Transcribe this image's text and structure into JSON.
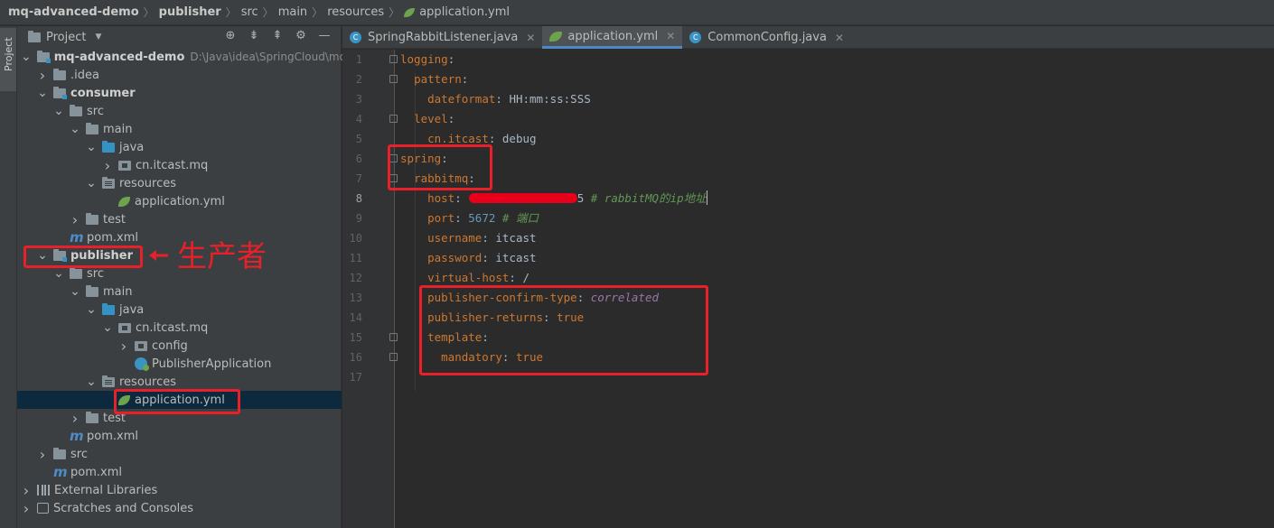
{
  "breadcrumb": [
    "mq-advanced-demo",
    "publisher",
    "src",
    "main",
    "resources",
    "application.yml"
  ],
  "sidebar_tab": "Project",
  "project_panel": {
    "title": "Project",
    "tree": [
      {
        "label": "mq-advanced-demo",
        "path": "D:\\Java\\idea\\SpringCloud\\mq-ac",
        "depth": 0,
        "chevron": "down",
        "icon": "module-folder",
        "bold": true
      },
      {
        "label": ".idea",
        "depth": 1,
        "chevron": "right",
        "icon": "folder"
      },
      {
        "label": "consumer",
        "depth": 1,
        "chevron": "down",
        "icon": "module-folder",
        "bold": true
      },
      {
        "label": "src",
        "depth": 2,
        "chevron": "down",
        "icon": "folder"
      },
      {
        "label": "main",
        "depth": 3,
        "chevron": "down",
        "icon": "folder"
      },
      {
        "label": "java",
        "depth": 4,
        "chevron": "down",
        "icon": "source-folder"
      },
      {
        "label": "cn.itcast.mq",
        "depth": 5,
        "chevron": "right",
        "icon": "package"
      },
      {
        "label": "resources",
        "depth": 4,
        "chevron": "down",
        "icon": "resources-folder"
      },
      {
        "label": "application.yml",
        "depth": 5,
        "chevron": "none",
        "icon": "spring-yml"
      },
      {
        "label": "test",
        "depth": 3,
        "chevron": "right",
        "icon": "folder"
      },
      {
        "label": "pom.xml",
        "depth": 2,
        "chevron": "none",
        "icon": "maven"
      },
      {
        "label": "publisher",
        "depth": 1,
        "chevron": "down",
        "icon": "module-folder",
        "bold": true
      },
      {
        "label": "src",
        "depth": 2,
        "chevron": "down",
        "icon": "folder"
      },
      {
        "label": "main",
        "depth": 3,
        "chevron": "down",
        "icon": "folder"
      },
      {
        "label": "java",
        "depth": 4,
        "chevron": "down",
        "icon": "source-folder"
      },
      {
        "label": "cn.itcast.mq",
        "depth": 5,
        "chevron": "down",
        "icon": "package"
      },
      {
        "label": "config",
        "depth": 6,
        "chevron": "right",
        "icon": "package"
      },
      {
        "label": "PublisherApplication",
        "depth": 6,
        "chevron": "none",
        "icon": "spring-class"
      },
      {
        "label": "resources",
        "depth": 4,
        "chevron": "down",
        "icon": "resources-folder"
      },
      {
        "label": "application.yml",
        "depth": 5,
        "chevron": "none",
        "icon": "spring-yml",
        "selected": true
      },
      {
        "label": "test",
        "depth": 3,
        "chevron": "right",
        "icon": "folder"
      },
      {
        "label": "pom.xml",
        "depth": 2,
        "chevron": "none",
        "icon": "maven"
      },
      {
        "label": "src",
        "depth": 1,
        "chevron": "right",
        "icon": "folder"
      },
      {
        "label": "pom.xml",
        "depth": 1,
        "chevron": "none",
        "icon": "maven"
      },
      {
        "label": "External Libraries",
        "depth": 0,
        "chevron": "right",
        "icon": "library"
      },
      {
        "label": "Scratches and Consoles",
        "depth": 0,
        "chevron": "right",
        "icon": "scratches"
      }
    ]
  },
  "tabs": [
    {
      "label": "SpringRabbitListener.java",
      "icon": "java-class",
      "active": false
    },
    {
      "label": "application.yml",
      "icon": "spring-yml",
      "active": true
    },
    {
      "label": "CommonConfig.java",
      "icon": "java-class",
      "active": false
    }
  ],
  "annotation": {
    "label": "生产者",
    "color": "#e8202a"
  },
  "editor": {
    "current_line": 8,
    "lines": [
      {
        "n": "1",
        "indent": "",
        "key": "logging",
        "sep": ":",
        "value": "",
        "value_style": "",
        "comment": "",
        "fold": true
      },
      {
        "n": "2",
        "indent": "  ",
        "key": "pattern",
        "sep": ":",
        "value": "",
        "value_style": "",
        "comment": "",
        "fold": true
      },
      {
        "n": "3",
        "indent": "    ",
        "key": "dateformat",
        "sep": ": ",
        "value": "HH:mm:ss:SSS",
        "value_style": "plain",
        "comment": "",
        "fold": false
      },
      {
        "n": "4",
        "indent": "  ",
        "key": "level",
        "sep": ":",
        "value": "",
        "value_style": "",
        "comment": "",
        "fold": true
      },
      {
        "n": "5",
        "indent": "    ",
        "key": "cn.itcast",
        "sep": ": ",
        "value": "debug",
        "value_style": "plain",
        "comment": "",
        "fold": false
      },
      {
        "n": "6",
        "indent": "",
        "key": "spring",
        "sep": ":",
        "value": "",
        "value_style": "",
        "comment": "",
        "fold": true
      },
      {
        "n": "7",
        "indent": "  ",
        "key": "rabbitmq",
        "sep": ":",
        "value": "",
        "value_style": "",
        "comment": "",
        "fold": true
      },
      {
        "n": "8",
        "indent": "    ",
        "key": "host",
        "sep": ":",
        "value": "5",
        "value_style": "redacted",
        "comment": " # rabbitMQ的ip地址",
        "fold": false
      },
      {
        "n": "9",
        "indent": "    ",
        "key": "port",
        "sep": ": ",
        "value": "5672",
        "value_style": "number",
        "comment": " # 端口",
        "fold": false
      },
      {
        "n": "10",
        "indent": "    ",
        "key": "username",
        "sep": ": ",
        "value": "itcast",
        "value_style": "plain",
        "comment": "",
        "fold": false
      },
      {
        "n": "11",
        "indent": "    ",
        "key": "password",
        "sep": ": ",
        "value": "itcast",
        "value_style": "plain",
        "comment": "",
        "fold": false
      },
      {
        "n": "12",
        "indent": "    ",
        "key": "virtual-host",
        "sep": ": ",
        "value": "/",
        "value_style": "plain",
        "comment": "",
        "fold": false
      },
      {
        "n": "13",
        "indent": "    ",
        "key": "publisher-confirm-type",
        "sep": ": ",
        "value": "correlated",
        "value_style": "italic",
        "comment": "",
        "fold": false
      },
      {
        "n": "14",
        "indent": "    ",
        "key": "publisher-returns",
        "sep": ": ",
        "value": "true",
        "value_style": "keyword",
        "comment": "",
        "fold": false
      },
      {
        "n": "15",
        "indent": "    ",
        "key": "template",
        "sep": ":",
        "value": "",
        "value_style": "",
        "comment": "",
        "fold": true
      },
      {
        "n": "16",
        "indent": "      ",
        "key": "mandatory",
        "sep": ": ",
        "value": "true",
        "value_style": "keyword",
        "comment": "",
        "fold": true
      },
      {
        "n": "17",
        "indent": "",
        "key": "",
        "sep": "",
        "value": "",
        "value_style": "",
        "comment": "",
        "fold": false
      }
    ]
  },
  "colors": {
    "annotation_red": "#e8202a",
    "keyword_orange": "#cc7832",
    "comment_green": "#629755",
    "selection_blue": "#0d293e"
  }
}
